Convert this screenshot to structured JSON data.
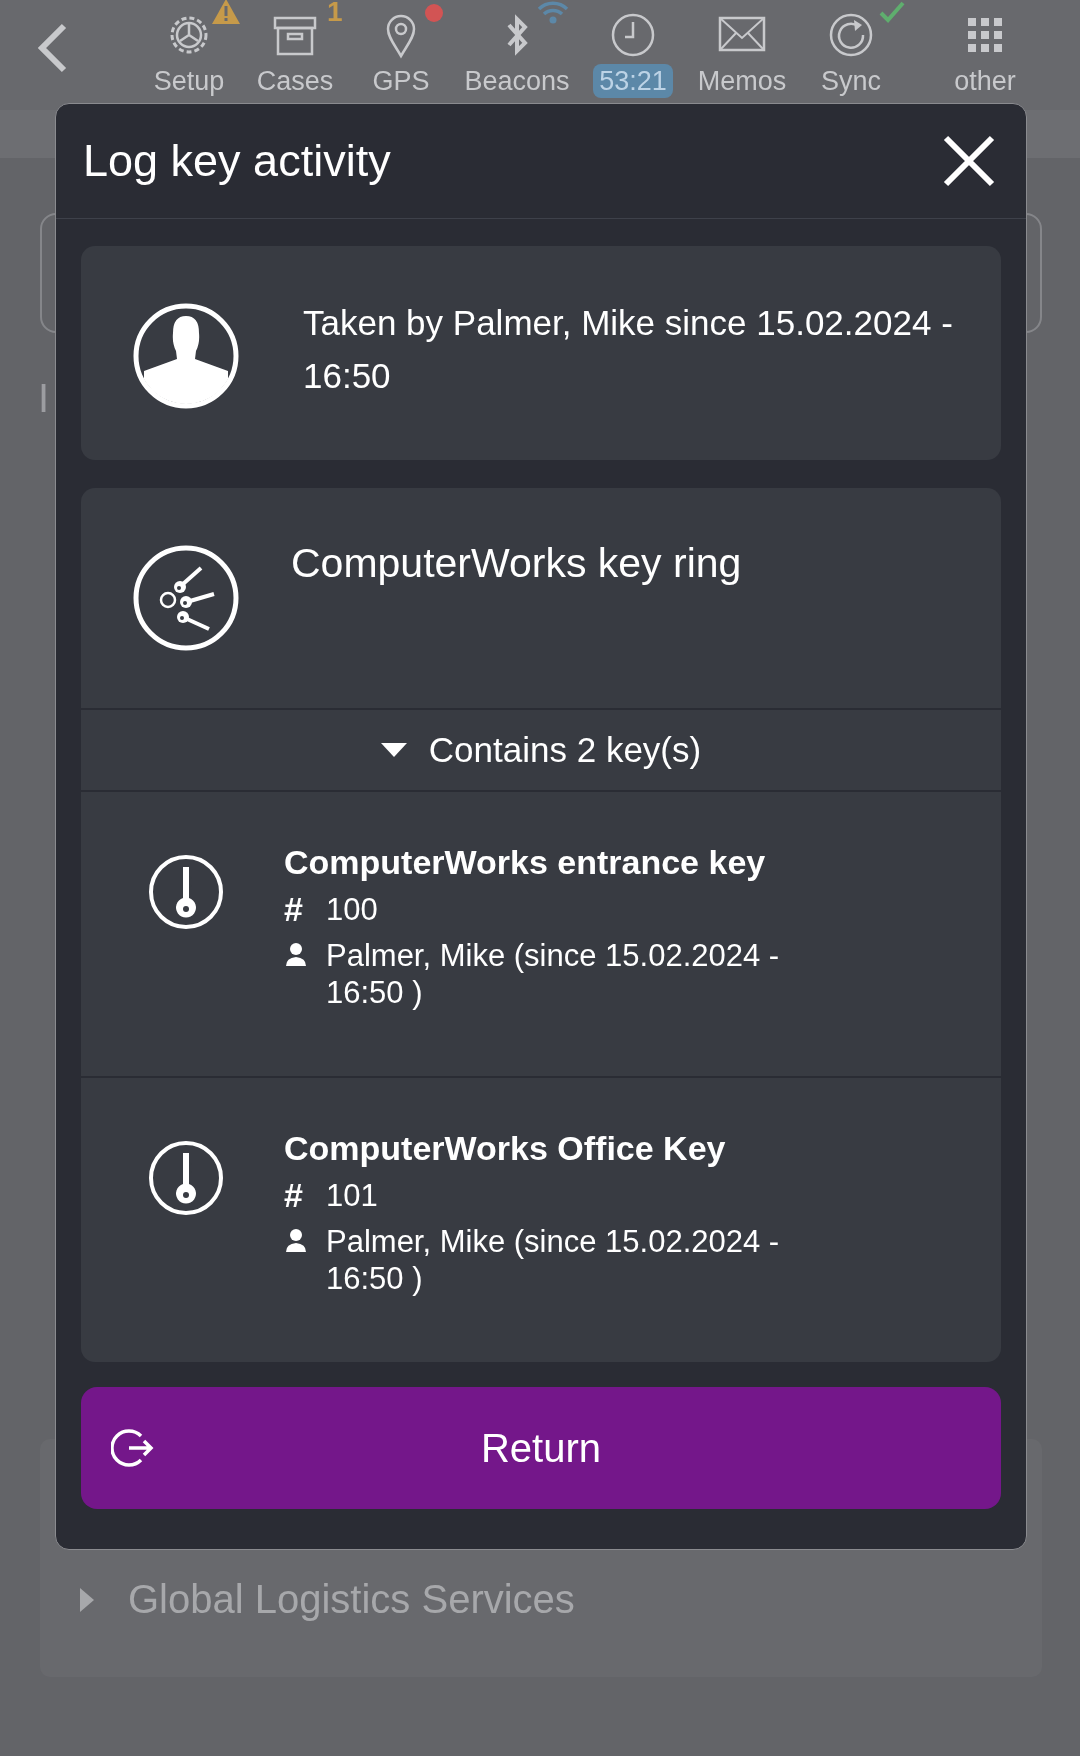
{
  "top_bar": {
    "items": [
      {
        "label": "Setup",
        "kind": "warning",
        "highlighted": false
      },
      {
        "label": "Cases",
        "kind": "count",
        "count": "1",
        "highlighted": false
      },
      {
        "label": "GPS",
        "kind": "dot",
        "highlighted": false
      },
      {
        "label": "Beacons",
        "kind": "signal",
        "highlighted": false
      },
      {
        "label": "53:21",
        "kind": "plain",
        "highlighted": true
      },
      {
        "label": "Memos",
        "kind": "plain",
        "highlighted": false
      },
      {
        "label": "Sync",
        "kind": "check",
        "highlighted": false
      },
      {
        "label": "other",
        "kind": "plain",
        "highlighted": false
      }
    ]
  },
  "background": {
    "labels": [
      "I"
    ],
    "section": {
      "title": "Global Logistics Services",
      "expanded": false
    }
  },
  "dialog": {
    "title": "Log key activity",
    "holder_card": {
      "text": "Taken by Palmer, Mike since 15.02.2024 - 16:50"
    },
    "key_ring": {
      "name": "ComputerWorks key ring",
      "contents_toggle": {
        "label": "Contains 2 key(s)",
        "expanded": true
      },
      "keys": [
        {
          "name": "ComputerWorks entrance key",
          "number_label": "#",
          "number": "100",
          "holder": "Palmer, Mike (since 15.02.2024 - 16:50 )"
        },
        {
          "name": "ComputerWorks Office Key",
          "number_label": "#",
          "number": "101",
          "holder": "Palmer, Mike (since 15.02.2024 - 16:50 )"
        }
      ]
    },
    "return_button": {
      "label": "Return"
    }
  }
}
